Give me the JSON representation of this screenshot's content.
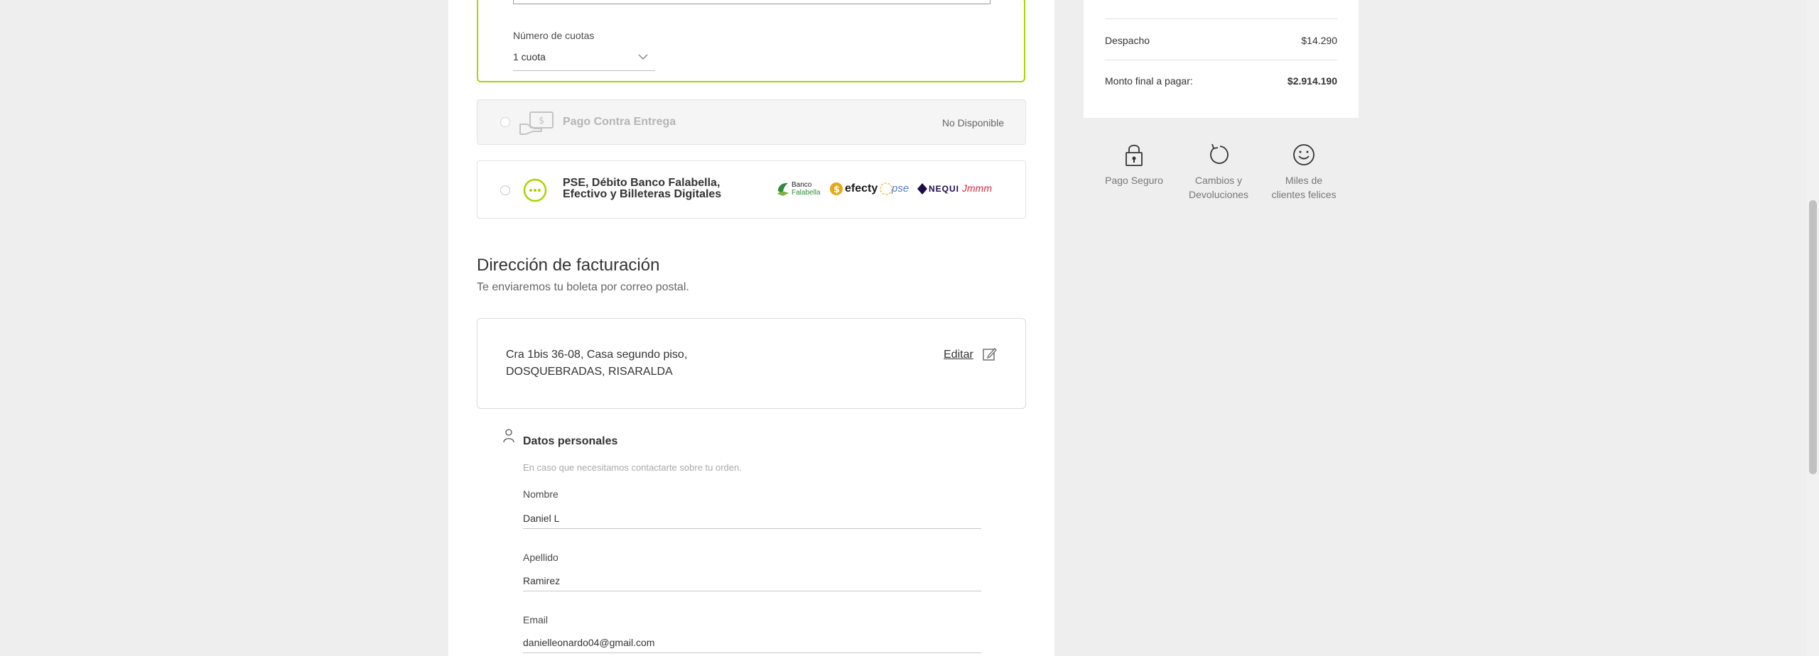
{
  "card_form": {
    "installments_label": "Número de cuotas",
    "installments_value": "1 cuota"
  },
  "payment_options": {
    "cod": {
      "label": "Pago Contra Entrega",
      "status": "No Disponible"
    },
    "pse": {
      "label_line1": "PSE, Débito Banco Falabella,",
      "label_line2": "Efectivo y Billeteras Digitales",
      "logos": {
        "banco_falabella_1": "Banco",
        "banco_falabella_2": "Falabella",
        "efecty": "efecty",
        "pse": "pse",
        "nequi": "NEQUI",
        "wallet": "Jmmm"
      }
    }
  },
  "billing": {
    "title": "Dirección de facturación",
    "subtitle": "Te enviaremos tu boleta por correo postal.",
    "address_line1": "Cra 1bis 36-08, Casa segundo piso,",
    "address_line2": "DOSQUEBRADAS, RISARALDA",
    "edit_label": "Editar"
  },
  "personal": {
    "title": "Datos personales",
    "subtitle": "En caso que necesitamos contactarte sobre tu orden.",
    "first_name_label": "Nombre",
    "first_name_value": "Daniel L",
    "last_name_label": "Apellido",
    "last_name_value": "Ramirez",
    "email_label": "Email",
    "email_value": "danielleonardo04@gmail.com"
  },
  "summary": {
    "shipping_label": "Despacho",
    "shipping_value": "$14.290",
    "total_label": "Monto final a pagar:",
    "total_value": "$2.914.190"
  },
  "trust": {
    "secure_1": "Pago Seguro",
    "returns_1": "Cambios y",
    "returns_2": "Devoluciones",
    "happy_1": "Miles de",
    "happy_2": "clientes felices"
  },
  "colors": {
    "accent_green": "#aad500",
    "page_bg": "#eeeeee",
    "falabella_green": "#2c8c3a",
    "efecty_gold": "#e6a817",
    "nequi_navy": "#200b4a",
    "wallet_red": "#d7263d"
  }
}
